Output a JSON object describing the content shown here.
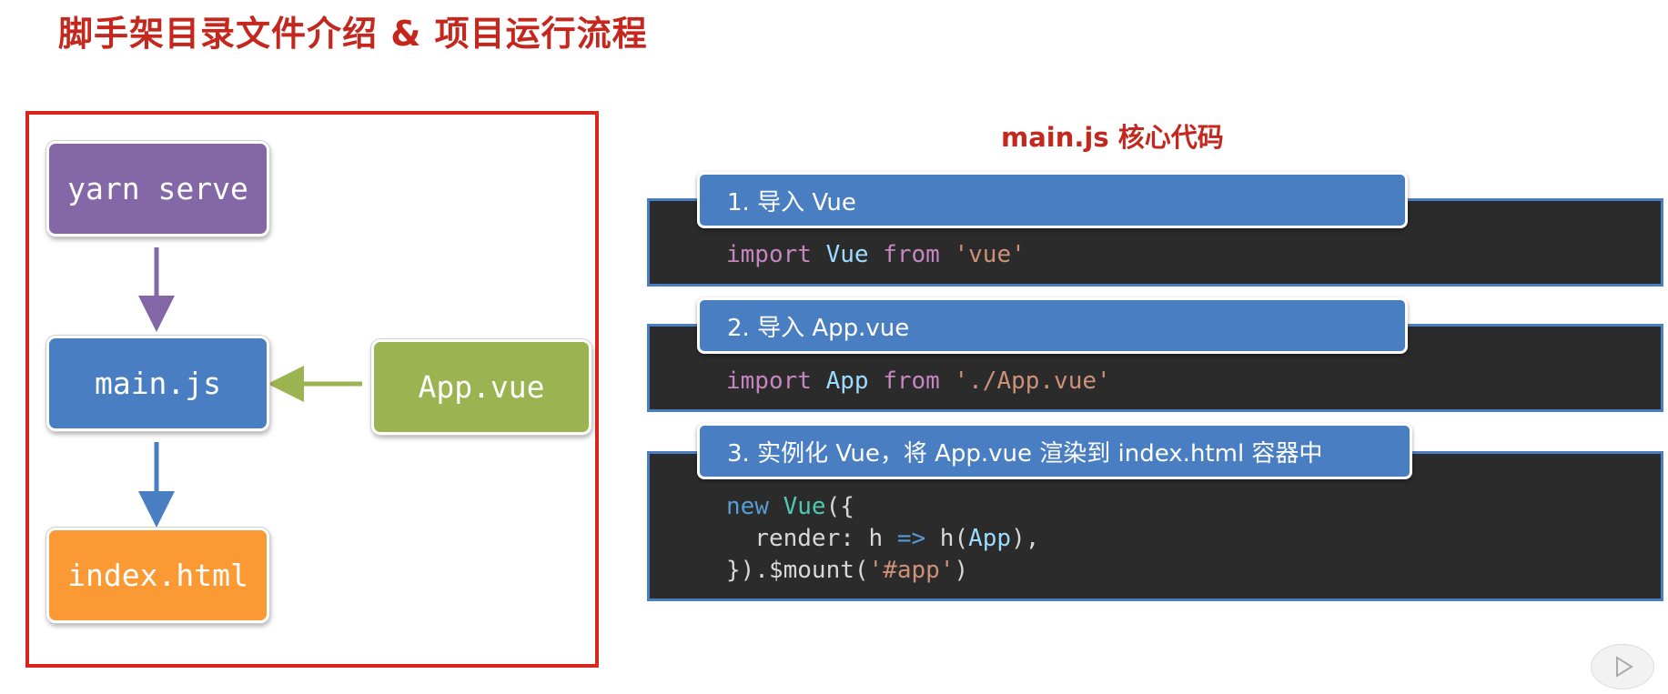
{
  "title": "脚手架目录文件介绍 & 项目运行流程",
  "flow": {
    "nodes": {
      "yarn": "yarn serve",
      "main": "main.js",
      "app": "App.vue",
      "index": "index.html"
    },
    "colors": {
      "frame": "#d9261c",
      "yarn": "#8367a7",
      "main": "#4a7ec3",
      "app": "#9cb351",
      "index": "#fb9a35"
    }
  },
  "code_section": {
    "heading": "main.js 核心代码",
    "steps": [
      {
        "label": "1. 导入 Vue",
        "code": {
          "kw": "import",
          "id": "Vue",
          "from": "from",
          "str": "'vue'"
        }
      },
      {
        "label": "2. 导入 App.vue",
        "code": {
          "kw": "import",
          "id": "App",
          "from": "from",
          "str": "'./App.vue'"
        }
      },
      {
        "label": "3. 实例化 Vue，将 App.vue 渲染到 index.html 容器中",
        "code": {
          "new": "new",
          "cls": "Vue",
          "open": "({",
          "render": "  render: h ",
          "arrow": "=>",
          "call": " h(",
          "arg": "App",
          "close_call": "),",
          "end_a": "}).$mount(",
          "mount_str": "'#app'",
          "end_b": ")"
        }
      }
    ]
  },
  "icons": {
    "player": "play-icon"
  }
}
